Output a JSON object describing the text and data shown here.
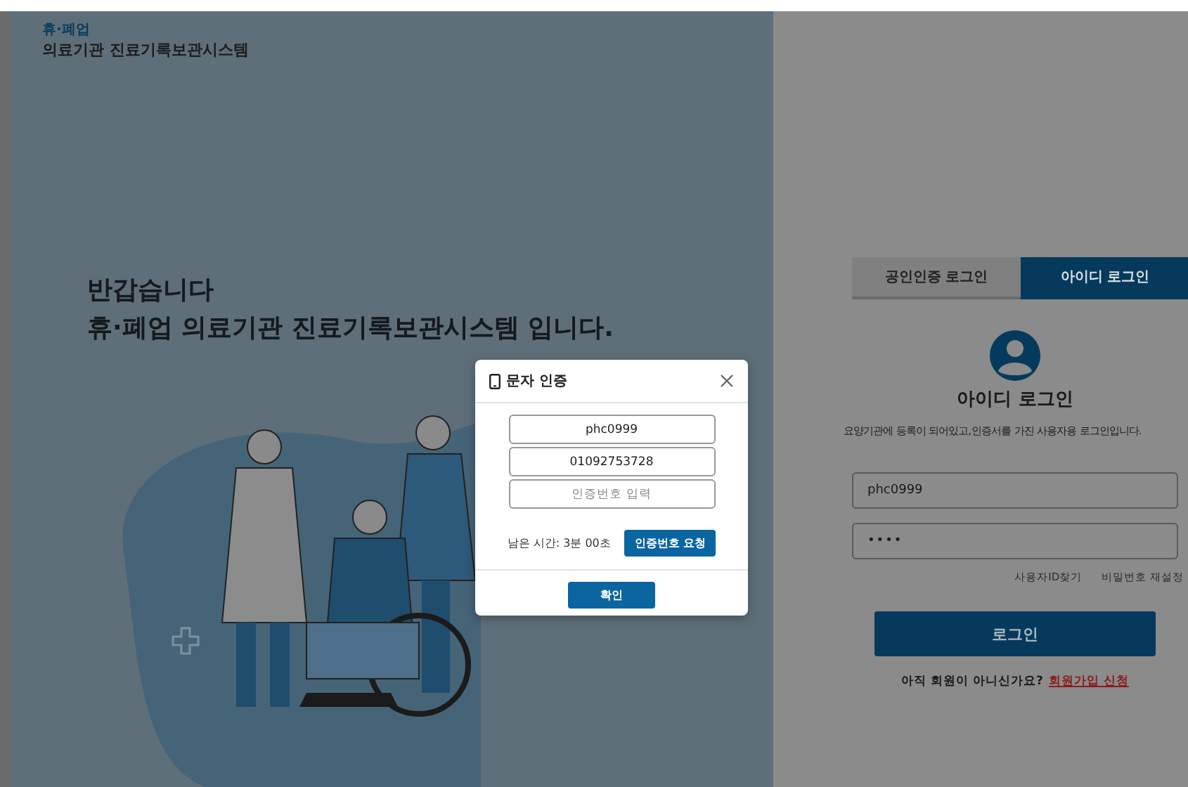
{
  "header": {
    "brand_top": "휴·폐업",
    "brand_bottom": "의료기관 진료기록보관시스템"
  },
  "hero": {
    "greeting": "반갑습니다",
    "title": "휴·폐업 의료기관 진료기록보관시스템 입니다."
  },
  "login": {
    "tabs": [
      {
        "label": "공인인증 로그인",
        "selected": false
      },
      {
        "label": "아이디 로그인",
        "selected": true
      }
    ],
    "title": "아이디 로그인",
    "description": "요양기관에 등록이 되어있고,인증서를 가진 사용자용 로그인입니다.",
    "fields": [
      {
        "kind": "text",
        "value": "phc0999"
      },
      {
        "kind": "password",
        "value": "••••"
      }
    ],
    "links": [
      "사용자ID찾기",
      "비밀번호 재설정"
    ],
    "button": "로그인",
    "signup_prompt": "아직 회원이 아니신가요?",
    "signup_link": "회원가입 신청"
  },
  "modal": {
    "title": "문자 인증",
    "fields": [
      {
        "value": "phc0999"
      },
      {
        "value": "01092753728"
      },
      {
        "placeholder": "인증번호 입력"
      }
    ],
    "timer": "남은 시간: 3분 00초",
    "request_button": "인증번호 요청",
    "confirm_button": "확인"
  }
}
